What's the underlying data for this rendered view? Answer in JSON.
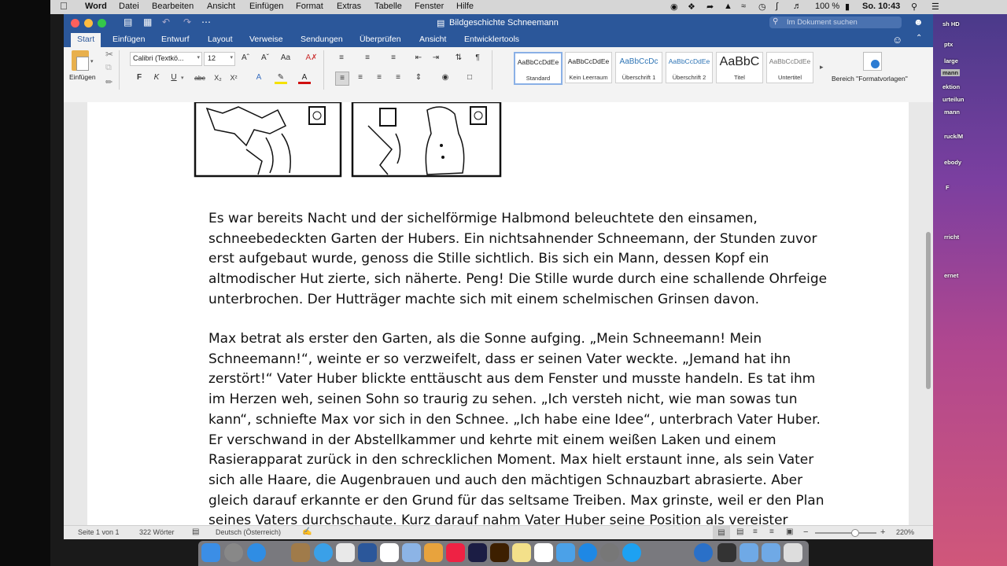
{
  "menubar": {
    "apple": "",
    "app_name": "Word",
    "items": [
      "Datei",
      "Bearbeiten",
      "Ansicht",
      "Einfügen",
      "Format",
      "Extras",
      "Tabelle",
      "Fenster",
      "Hilfe"
    ],
    "battery": "100 %",
    "clock": "So. 10:43"
  },
  "window": {
    "title": "Bildgeschichte Schneemann",
    "search_placeholder": "Im Dokument suchen"
  },
  "ribbon_tabs": [
    "Start",
    "Einfügen",
    "Entwurf",
    "Layout",
    "Verweise",
    "Sendungen",
    "Überprüfen",
    "Ansicht",
    "Entwicklertools"
  ],
  "ribbon": {
    "paste_label": "Einfügen",
    "font_name": "Calibri (Textkö...",
    "font_size": "12",
    "styles": [
      {
        "preview": "AaBbCcDdEe",
        "name": "Standard"
      },
      {
        "preview": "AaBbCcDdEe",
        "name": "Kein Leerraum"
      },
      {
        "preview": "AaBbCcDc",
        "name": "Überschrift 1"
      },
      {
        "preview": "AaBbCcDdEe",
        "name": "Überschrift 2"
      },
      {
        "preview": "AaBbC",
        "name": "Titel"
      },
      {
        "preview": "AaBbCcDdEe",
        "name": "Untertitel"
      }
    ],
    "styles_pane_label": "Bereich \"Formatvorlagen\""
  },
  "document": {
    "para1": [
      "Es war bereits Nacht und der sichelförmige Halbmond beleuchtete den einsamen,",
      "schneebedeckten Garten der Hubers. Ein nichtsahnender Schneemann, der Stunden zuvor",
      "erst aufgebaut wurde, genoss die Stille sichtlich. Bis sich ein Mann, dessen Kopf ein",
      "altmodischer Hut zierte, sich näherte. Peng! Die Stille wurde durch eine schallende Ohrfeige",
      "unterbrochen. Der Hutträger machte sich mit einem schelmischen Grinsen davon."
    ],
    "para2": [
      "Max betrat als erster den Garten, als die Sonne aufging. „Mein Schneemann! Mein",
      "Schneemann!“, weinte er so verzweifelt, dass er seinen Vater weckte. „Jemand hat ihn",
      "zerstört!“ Vater Huber blickte enttäuscht aus dem Fenster und musste handeln. Es tat ihm",
      "im Herzen weh, seinen Sohn so traurig zu sehen. „Ich versteh nicht, wie man sowas tun",
      "kann“, schniefte Max vor sich in den Schnee. „Ich habe eine Idee“, unterbrach Vater Huber.",
      "Er verschwand in der Abstellkammer und kehrte mit einem weißen Laken und einem",
      "Rasierapparat zurück in den schrecklichen Moment. Max hielt erstaunt inne, als sein Vater",
      "sich alle Haare, die Augenbrauen und auch den mächtigen Schnauzbart abrasierte. Aber",
      "gleich darauf erkannte er den Grund für das seltsame Treiben. Max grinste, weil er den Plan",
      "seines Vaters durchschaute. Kurz darauf nahm Vater Huber seine Position als vereister"
    ]
  },
  "statusbar": {
    "page": "Seite 1 von 1",
    "words": "322 Wörter",
    "language": "Deutsch (Österreich)",
    "zoom": "220%"
  },
  "desktop_labels": [
    "sh HD",
    "ptx",
    "large",
    "mann",
    "ektion",
    "urteilun",
    "mann",
    "ruck/M",
    "ebody",
    "F",
    "rricht",
    "ernet"
  ]
}
